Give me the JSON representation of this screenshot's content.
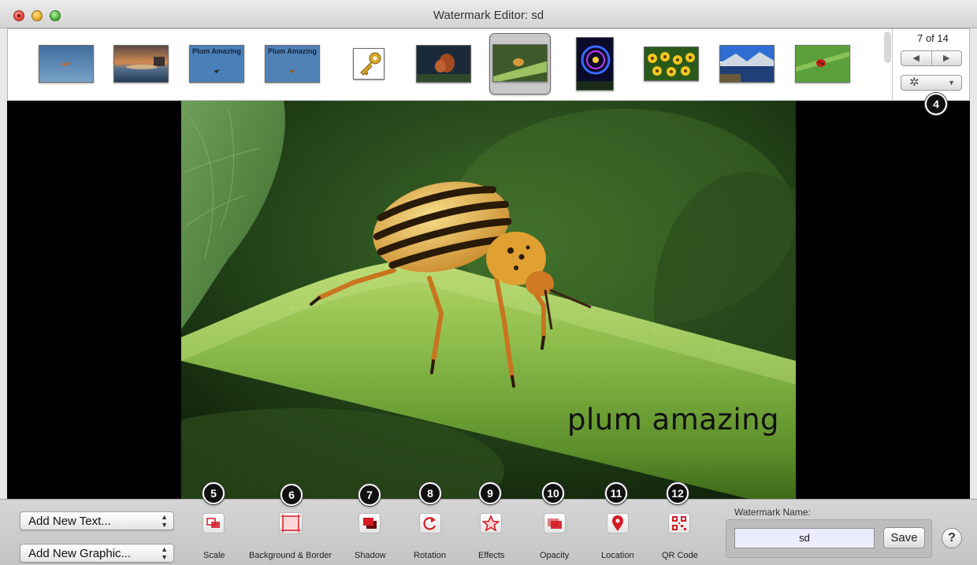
{
  "window": {
    "title": "Watermark Editor: sd"
  },
  "filmstrip": {
    "counter": "7 of 14",
    "thumbnails": [
      {
        "name": "thumb-sky-plane",
        "caption": ""
      },
      {
        "name": "thumb-sunset-sea",
        "caption": ""
      },
      {
        "name": "thumb-plum-amazing-1",
        "caption": "Plum Amazing"
      },
      {
        "name": "thumb-plum-amazing-2",
        "caption": "Plum Amazing"
      },
      {
        "name": "thumb-key",
        "caption": ""
      },
      {
        "name": "thumb-butterfly",
        "caption": ""
      },
      {
        "name": "thumb-beetle",
        "caption": ""
      },
      {
        "name": "thumb-ferris-wheel",
        "caption": ""
      },
      {
        "name": "thumb-sunflowers",
        "caption": ""
      },
      {
        "name": "thumb-mountain-lake",
        "caption": ""
      },
      {
        "name": "thumb-ladybug",
        "caption": ""
      }
    ],
    "selected_index": 6
  },
  "preview": {
    "watermark_text": "plum amazing"
  },
  "callouts": [
    "4",
    "5",
    "6",
    "7",
    "8",
    "9",
    "10",
    "11",
    "12"
  ],
  "toolbar": {
    "add_text": "Add New Text...",
    "add_graphic": "Add New Graphic...",
    "tools": [
      {
        "label": "Scale",
        "icon": "scale-icon"
      },
      {
        "label": "Background & Border",
        "icon": "background-border-icon"
      },
      {
        "label": "Shadow",
        "icon": "shadow-icon"
      },
      {
        "label": "Rotation",
        "icon": "rotation-icon"
      },
      {
        "label": "Effects",
        "icon": "effects-icon"
      },
      {
        "label": "Opacity",
        "icon": "opacity-icon"
      },
      {
        "label": "Location",
        "icon": "location-icon"
      },
      {
        "label": "QR Code",
        "icon": "qr-code-icon"
      }
    ],
    "watermark_name_label": "Watermark Name:",
    "watermark_name_value": "sd",
    "save_label": "Save",
    "help_label": "?"
  },
  "colors": {
    "tool_accent": "#d31c26",
    "input_bg": "#ececff",
    "preview_bg": "#000000"
  }
}
